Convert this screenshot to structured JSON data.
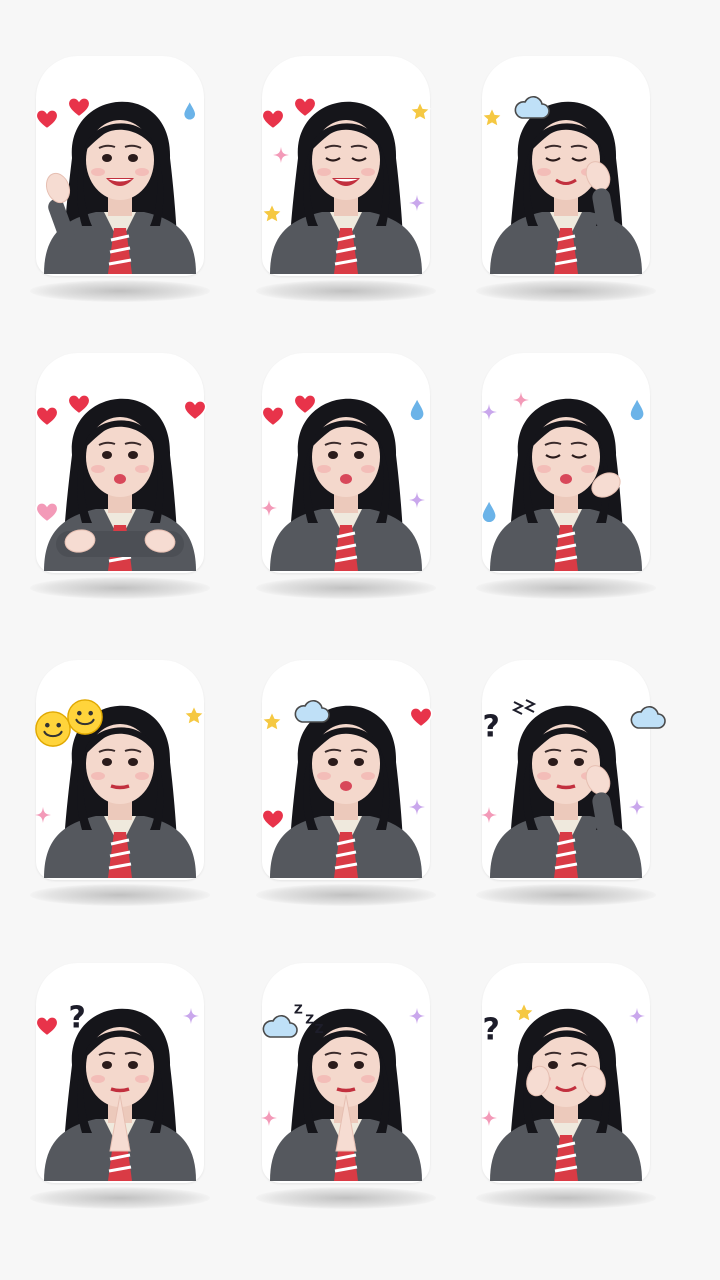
{
  "sheet": {
    "background": "#f7f7f7",
    "stickers": [
      {
        "id": "wave",
        "pose": "waving-hand",
        "expression": "big-smile",
        "decorations": [
          "heart",
          "heart",
          "droplet-moon"
        ]
      },
      {
        "id": "laugh",
        "pose": "arms-down",
        "expression": "eyes-closed-laugh",
        "decorations": [
          "heart",
          "heart",
          "star",
          "star",
          "sparkle",
          "sparkle"
        ]
      },
      {
        "id": "dreamy",
        "pose": "hand-on-cheek",
        "expression": "eyes-closed-smile",
        "decorations": [
          "star",
          "cloud"
        ]
      },
      {
        "id": "pout-arms",
        "pose": "arms-crossed",
        "expression": "pout",
        "decorations": [
          "heart",
          "heart",
          "heart",
          "pink-heart"
        ]
      },
      {
        "id": "kiss",
        "pose": "arms-down",
        "expression": "kiss-face",
        "decorations": [
          "heart",
          "heart",
          "droplet",
          "sparkle",
          "sparkle"
        ]
      },
      {
        "id": "blow-kiss",
        "pose": "hand-out-blow",
        "expression": "kiss-eyes-closed",
        "decorations": [
          "sparkle",
          "sparkle",
          "droplet",
          "droplet"
        ]
      },
      {
        "id": "neutral-smileys",
        "pose": "arms-down",
        "expression": "neutral",
        "decorations": [
          "smiley",
          "smiley",
          "star",
          "sparkle"
        ]
      },
      {
        "id": "shy",
        "pose": "arms-down",
        "expression": "slight-pout",
        "decorations": [
          "star",
          "cloud",
          "heart",
          "heart",
          "sparkle"
        ]
      },
      {
        "id": "confused",
        "pose": "hand-on-cheek",
        "expression": "puzzled",
        "decorations": [
          "question-mark",
          "zigzag",
          "cloud",
          "sparkle",
          "sparkle"
        ]
      },
      {
        "id": "pray-heart",
        "pose": "hands-together",
        "expression": "neutral",
        "decorations": [
          "heart",
          "question-mark",
          "sparkle"
        ]
      },
      {
        "id": "pray-sleepy",
        "pose": "hands-together",
        "expression": "neutral",
        "decorations": [
          "cloud",
          "zzz",
          "sparkle",
          "sparkle"
        ]
      },
      {
        "id": "cheeks-wink",
        "pose": "hands-on-cheeks",
        "expression": "wink",
        "decorations": [
          "question-mark",
          "star",
          "sparkle",
          "sparkle"
        ]
      }
    ],
    "palette": {
      "heart": "#e8334a",
      "pink": "#f39ab8",
      "star": "#f5c842",
      "blue": "#6bb3e8",
      "hair": "#15151a",
      "jacket": "#55585e",
      "tie": "#d93b45",
      "skin": "#f4d8cc"
    }
  }
}
